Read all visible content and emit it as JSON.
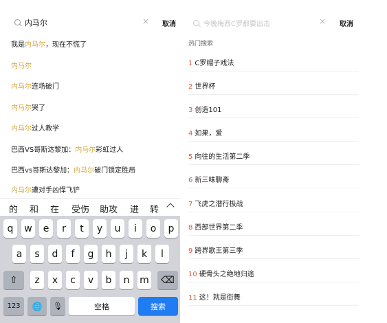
{
  "left": {
    "query": "内马尔",
    "cancel": "取消",
    "suggestions": [
      {
        "pre": "我是",
        "hl": "内马尔",
        "post": "，现在不慌了"
      },
      {
        "pre": "",
        "hl": "内马尔",
        "post": ""
      },
      {
        "pre": "",
        "hl": "内马尔",
        "post": "连场破门"
      },
      {
        "pre": "",
        "hl": "内马尔",
        "post": "哭了"
      },
      {
        "pre": "",
        "hl": "内马尔",
        "post": "过人教学"
      },
      {
        "pre": "巴西VS哥斯达黎加：",
        "hl": "内马尔",
        "post": "彩虹过人"
      },
      {
        "pre": "巴西vs哥斯达黎加：",
        "hl": "内马尔",
        "post": "破门锁定胜局"
      },
      {
        "pre": "",
        "hl": "内马尔",
        "post": "遭对手凶悍飞铲"
      }
    ],
    "candidates": [
      "的",
      "和",
      "在",
      "受伤",
      "助攻",
      "进",
      "转"
    ],
    "keyboard": {
      "row1": [
        "q",
        "w",
        "e",
        "r",
        "t",
        "y",
        "u",
        "i",
        "o",
        "p"
      ],
      "row2": [
        "a",
        "s",
        "d",
        "f",
        "g",
        "h",
        "j",
        "k",
        "l"
      ],
      "row3": [
        "z",
        "x",
        "c",
        "v",
        "b",
        "n",
        "m"
      ],
      "shift": "⇧",
      "delete": "⌫",
      "num": "123",
      "globe": "🌐",
      "mic": "🎙",
      "space": "空格",
      "search": "搜索"
    }
  },
  "right": {
    "placeholder": "今晚梅西C罗都要出击",
    "cancel": "取消",
    "section_title": "热门搜索",
    "hot": [
      {
        "rank": "1",
        "text": "C罗帽子戏法"
      },
      {
        "rank": "2",
        "text": "世界杯"
      },
      {
        "rank": "3",
        "text": "创造101"
      },
      {
        "rank": "4",
        "text": "如果，爱"
      },
      {
        "rank": "5",
        "text": "向往的生活第二季"
      },
      {
        "rank": "6",
        "text": "新三味聊斋"
      },
      {
        "rank": "7",
        "text": "飞虎之潜行极战"
      },
      {
        "rank": "8",
        "text": "西部世界第二季"
      },
      {
        "rank": "9",
        "text": "跨界歌王第三季"
      },
      {
        "rank": "10",
        "text": "硬骨头之绝地归途"
      },
      {
        "rank": "11",
        "text": "这！就是街舞"
      }
    ]
  }
}
